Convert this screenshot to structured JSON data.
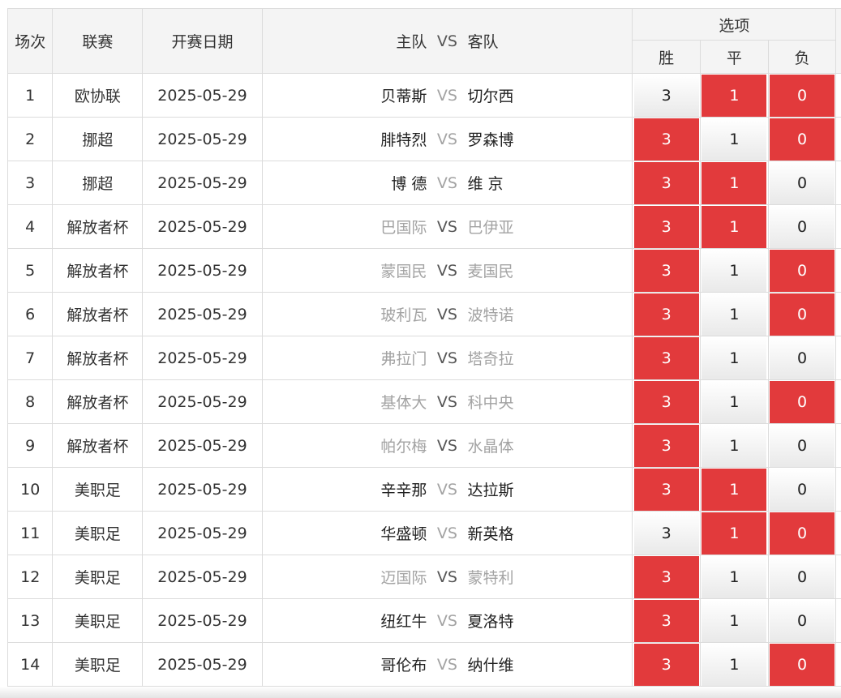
{
  "header": {
    "col_num": "场次",
    "col_league": "联赛",
    "col_date": "开赛日期",
    "col_home": "主队",
    "col_vs": "VS",
    "col_away": "客队",
    "options_title": "选项",
    "opt_win": "胜",
    "opt_draw": "平",
    "opt_lose": "负"
  },
  "colors": {
    "selected": "#e23a3c",
    "unselected": "#f4f4f4",
    "team_grey": "#a3a3a3"
  },
  "matches": [
    {
      "num": "1",
      "league": "欧协联",
      "date": "2025-05-29",
      "home": "贝蒂斯",
      "away": "切尔西",
      "win": "3",
      "draw": "1",
      "lose": "0"
    },
    {
      "num": "2",
      "league": "挪超",
      "date": "2025-05-29",
      "home": "腓特烈",
      "away": "罗森博",
      "win": "3",
      "draw": "1",
      "lose": "0"
    },
    {
      "num": "3",
      "league": "挪超",
      "date": "2025-05-29",
      "home": "博 德",
      "away": "维 京",
      "win": "3",
      "draw": "1",
      "lose": "0"
    },
    {
      "num": "4",
      "league": "解放者杯",
      "date": "2025-05-29",
      "home": "巴国际",
      "away": "巴伊亚",
      "win": "3",
      "draw": "1",
      "lose": "0"
    },
    {
      "num": "5",
      "league": "解放者杯",
      "date": "2025-05-29",
      "home": "蒙国民",
      "away": "麦国民",
      "win": "3",
      "draw": "1",
      "lose": "0"
    },
    {
      "num": "6",
      "league": "解放者杯",
      "date": "2025-05-29",
      "home": "玻利瓦",
      "away": "波特诺",
      "win": "3",
      "draw": "1",
      "lose": "0"
    },
    {
      "num": "7",
      "league": "解放者杯",
      "date": "2025-05-29",
      "home": "弗拉门",
      "away": "塔奇拉",
      "win": "3",
      "draw": "1",
      "lose": "0"
    },
    {
      "num": "8",
      "league": "解放者杯",
      "date": "2025-05-29",
      "home": "基体大",
      "away": "科中央",
      "win": "3",
      "draw": "1",
      "lose": "0"
    },
    {
      "num": "9",
      "league": "解放者杯",
      "date": "2025-05-29",
      "home": "帕尔梅",
      "away": "水晶体",
      "win": "3",
      "draw": "1",
      "lose": "0"
    },
    {
      "num": "10",
      "league": "美职足",
      "date": "2025-05-29",
      "home": "辛辛那",
      "away": "达拉斯",
      "win": "3",
      "draw": "1",
      "lose": "0"
    },
    {
      "num": "11",
      "league": "美职足",
      "date": "2025-05-29",
      "home": "华盛顿",
      "away": "新英格",
      "win": "3",
      "draw": "1",
      "lose": "0"
    },
    {
      "num": "12",
      "league": "美职足",
      "date": "2025-05-29",
      "home": "迈国际",
      "away": "蒙特利",
      "win": "3",
      "draw": "1",
      "lose": "0"
    },
    {
      "num": "13",
      "league": "美职足",
      "date": "2025-05-29",
      "home": "纽红牛",
      "away": "夏洛特",
      "win": "3",
      "draw": "1",
      "lose": "0"
    },
    {
      "num": "14",
      "league": "美职足",
      "date": "2025-05-29",
      "home": "哥伦布",
      "away": "纳什维",
      "win": "3",
      "draw": "1",
      "lose": "0"
    }
  ]
}
